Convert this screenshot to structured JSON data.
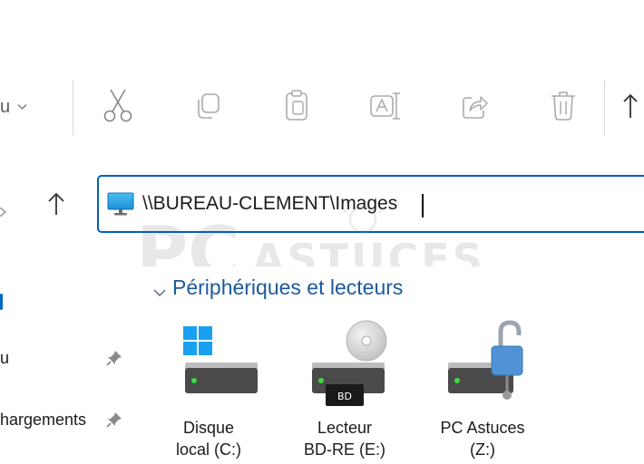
{
  "toolbar": {
    "view_label_fragment": "u",
    "buttons": [
      {
        "name": "cut",
        "icon": "scissors-icon"
      },
      {
        "name": "copy",
        "icon": "copy-icon"
      },
      {
        "name": "paste",
        "icon": "clipboard-icon"
      },
      {
        "name": "rename",
        "icon": "rename-icon"
      },
      {
        "name": "share",
        "icon": "share-icon"
      },
      {
        "name": "delete",
        "icon": "trash-icon"
      }
    ]
  },
  "address_bar": {
    "value": "\\\\BUREAU-CLEMENT\\Images",
    "icon": "computer-monitor-icon"
  },
  "sidebar": {
    "items": [
      {
        "label": "u",
        "pinned": true
      },
      {
        "label": "hargements",
        "pinned": true
      }
    ]
  },
  "watermark": {
    "text_big": "PC",
    "text_small": "ASTUCES"
  },
  "content": {
    "group_header": "Périphériques et lecteurs",
    "drives": [
      {
        "line1": "Disque",
        "line2": "local (C:)",
        "icon": "windows-drive-icon"
      },
      {
        "line1": "Lecteur",
        "line2": "BD-RE (E:)",
        "icon": "bluray-drive-icon",
        "badge": "BD"
      },
      {
        "line1": "PC Astuces",
        "line2": "(Z:)",
        "icon": "network-drive-unlocked-icon"
      }
    ]
  },
  "colors": {
    "accent": "#005fb8",
    "link_blue": "#1b5a9e",
    "drive_body": "#4a4a4a",
    "drive_led": "#3ddc3d"
  }
}
